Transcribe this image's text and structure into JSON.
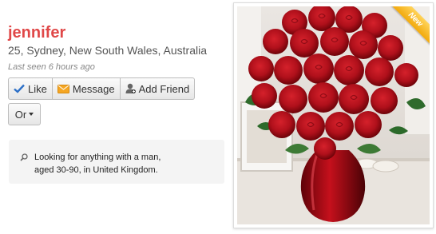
{
  "profile": {
    "name": "jennifer",
    "location": "25, Sydney, New South Wales, Australia",
    "last_seen": "Last seen 6 hours ago"
  },
  "actions": {
    "like": "Like",
    "message": "Message",
    "add_friend": "Add Friend",
    "or": "Or"
  },
  "looking_for": {
    "line1": "Looking for anything with a man,",
    "line2": "aged 30-90, in United Kingdom."
  },
  "photo": {
    "badge": "New"
  },
  "colors": {
    "name": "#e04848",
    "badge": "#f2a90c"
  }
}
